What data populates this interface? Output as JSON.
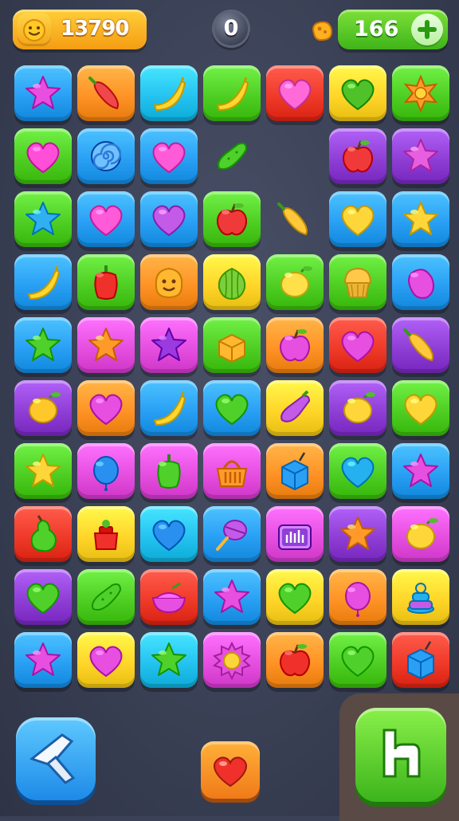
{
  "hud": {
    "score": "13790",
    "moves": "0",
    "coins": "166",
    "score_icon": "smiley-icon",
    "coin_icon": "coin-icon",
    "add_icon": "plus-icon"
  },
  "colors": {
    "blue": "#2aa0f5",
    "orange": "#ff9326",
    "green": "#4fcf23",
    "red": "#f03a2a",
    "yellow": "#ffd629",
    "purple": "#8f3fd6",
    "pink": "#e64fe0",
    "cyan": "#25c3f0"
  },
  "grid": [
    [
      [
        "blue",
        "star",
        "#e84fe0"
      ],
      [
        "orange",
        "chili",
        "#f0484a"
      ],
      [
        "cyan",
        "banana",
        "#ffd630"
      ],
      [
        "green",
        "banana",
        "#ffd630"
      ],
      [
        "red",
        "heart",
        "#ff6ad8"
      ],
      [
        "yellow",
        "heart",
        "#4fc22a"
      ],
      [
        "green",
        "flower",
        "#ff9a2a"
      ]
    ],
    [
      [
        "green",
        "heart",
        "#ff4fd8"
      ],
      [
        "blue",
        "swirl",
        "#2a7bd8"
      ],
      [
        "blue",
        "heart",
        "#ff5ad8"
      ],
      null,
      null,
      [
        "purple",
        "apple",
        "#f03a3a"
      ],
      [
        "purple",
        "star",
        "#e75fe0"
      ]
    ],
    [
      [
        "green",
        "star",
        "#30b0f0"
      ],
      [
        "blue",
        "heart",
        "#ff5ad8"
      ],
      [
        "blue",
        "heart",
        "#c45ae8"
      ],
      [
        "green",
        "apple",
        "#f03a3a"
      ],
      null,
      [
        "blue",
        "heart",
        "#ffd63a"
      ],
      [
        "blue",
        "star",
        "#ffd63a"
      ]
    ],
    [
      [
        "blue",
        "banana",
        "#ffd630"
      ],
      [
        "green",
        "pepper",
        "#f0302a"
      ],
      [
        "orange",
        "smiley",
        "#ffb830"
      ],
      [
        "yellow",
        "fruit",
        "#7ad03a"
      ],
      [
        "green",
        "lemon",
        "#ffe04a"
      ],
      [
        "green",
        "cupcake",
        "#ffc84a"
      ],
      [
        "blue",
        "bean",
        "#e64fe0"
      ]
    ],
    [
      [
        "blue",
        "star",
        "#4fd02a"
      ],
      [
        "pink",
        "star",
        "#ff9a2a"
      ],
      [
        "pink",
        "star",
        "#9a3ae0"
      ],
      [
        "green",
        "box",
        "#ffb830"
      ],
      [
        "orange",
        "apple",
        "#e64fe0"
      ],
      [
        "red",
        "heart",
        "#e64fe0"
      ],
      [
        "purple",
        "chili",
        "#ffc83a"
      ]
    ],
    [
      [
        "purple",
        "lemon",
        "#ffc82a"
      ],
      [
        "orange",
        "heart",
        "#e64fe0"
      ],
      [
        "blue",
        "banana",
        "#ffd630"
      ],
      [
        "blue",
        "heart",
        "#4fd02a"
      ],
      [
        "yellow",
        "eggplant",
        "#c45ae8"
      ],
      [
        "purple",
        "lemon",
        "#ffd63a"
      ],
      [
        "green",
        "heart",
        "#ffd63a"
      ]
    ],
    [
      [
        "green",
        "star",
        "#ffd63a"
      ],
      [
        "pink",
        "balloon",
        "#2a90f0"
      ],
      [
        "pink",
        "pepper",
        "#4fd02a"
      ],
      [
        "pink",
        "basket",
        "#ff9a2a"
      ],
      [
        "orange",
        "cube",
        "#2aa0f5"
      ],
      [
        "green",
        "heart",
        "#25b0f0"
      ],
      [
        "blue",
        "star",
        "#e64fe0"
      ]
    ],
    [
      [
        "red",
        "pear",
        "#4fd02a"
      ],
      [
        "yellow",
        "jar",
        "#f0302a"
      ],
      [
        "cyan",
        "heart",
        "#2a90f0"
      ],
      [
        "blue",
        "rattle",
        "#c45ae8"
      ],
      [
        "pink",
        "radio",
        "#8f3fd6"
      ],
      [
        "purple",
        "star",
        "#ff9a2a"
      ],
      [
        "pink",
        "lemon",
        "#ffd63a"
      ]
    ],
    [
      [
        "purple",
        "heart",
        "#4fd02a"
      ],
      [
        "green",
        "pickle",
        "#4fd02a"
      ],
      [
        "red",
        "bowl",
        "#e64fe0"
      ],
      [
        "blue",
        "star",
        "#e64fe0"
      ],
      [
        "yellow",
        "heart",
        "#4fd02a"
      ],
      [
        "orange",
        "balloon",
        "#e64fe0"
      ],
      [
        "yellow",
        "stack",
        "#25b0f0"
      ]
    ],
    [
      [
        "blue",
        "star",
        "#e64fe0"
      ],
      [
        "yellow",
        "heart",
        "#e64fe0"
      ],
      [
        "cyan",
        "star",
        "#4fd02a"
      ],
      [
        "pink",
        "sun",
        "#ffd63a"
      ],
      [
        "orange",
        "apple",
        "#f0302a"
      ],
      [
        "green",
        "heart",
        "#4fd02a"
      ],
      [
        "red",
        "cube",
        "#2aa0f5"
      ]
    ]
  ],
  "loose_items": [
    [
      "pickle",
      "#4fd02a"
    ],
    [
      "chili",
      "#ffc83a"
    ]
  ],
  "controls": {
    "back_icon": "hammer-icon",
    "booster_icon": "heart-icon",
    "hint_icon": "hint-arrow-icon"
  }
}
